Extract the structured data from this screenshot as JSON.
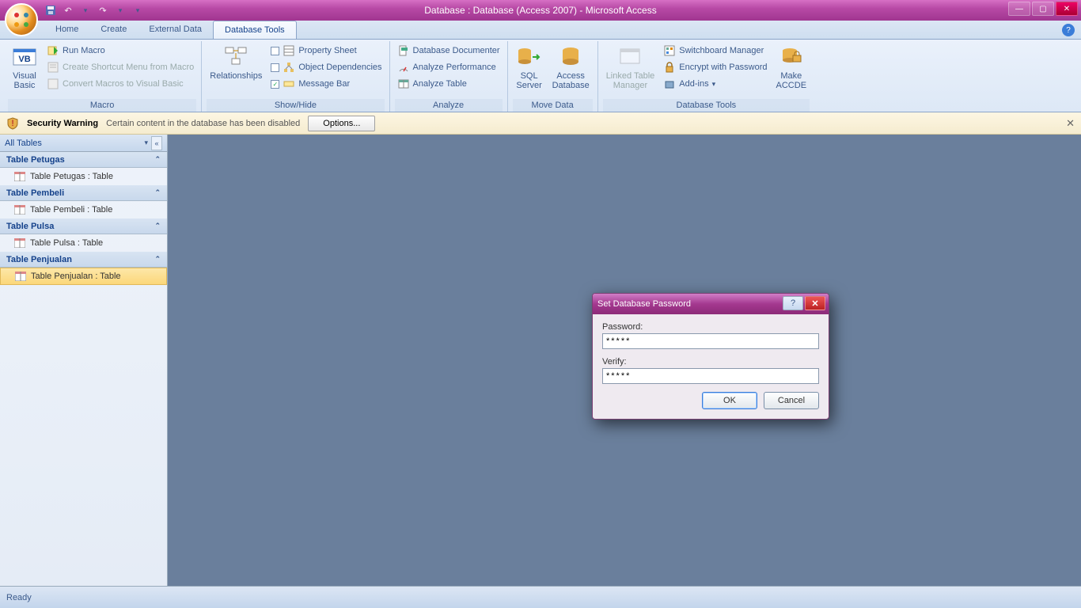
{
  "titlebar": {
    "title": "Database : Database (Access 2007) - Microsoft Access"
  },
  "tabs": [
    {
      "label": "Home"
    },
    {
      "label": "Create"
    },
    {
      "label": "External Data"
    },
    {
      "label": "Database Tools"
    }
  ],
  "ribbon": {
    "macro": {
      "label": "Macro",
      "visual_basic": "Visual\nBasic",
      "run_macro": "Run Macro",
      "shortcut": "Create Shortcut Menu from Macro",
      "convert": "Convert Macros to Visual Basic"
    },
    "showhide": {
      "label": "Show/Hide",
      "relationships": "Relationships",
      "propsheet": "Property Sheet",
      "objdep": "Object Dependencies",
      "msgbar": "Message Bar"
    },
    "analyze": {
      "label": "Analyze",
      "documenter": "Database Documenter",
      "perf": "Analyze Performance",
      "table": "Analyze Table"
    },
    "movedata": {
      "label": "Move Data",
      "sql": "SQL\nServer",
      "access": "Access\nDatabase"
    },
    "dbtools": {
      "label": "Database Tools",
      "linked": "Linked Table\nManager",
      "switchboard": "Switchboard Manager",
      "encrypt": "Encrypt with Password",
      "addins": "Add-ins",
      "accde": "Make\nACCDE"
    }
  },
  "security": {
    "title": "Security Warning",
    "msg": "Certain content in the database has been disabled",
    "options": "Options..."
  },
  "nav": {
    "header": "All Tables",
    "groups": [
      {
        "name": "Table Petugas",
        "item": "Table Petugas : Table"
      },
      {
        "name": "Table Pembeli",
        "item": "Table Pembeli : Table"
      },
      {
        "name": "Table Pulsa",
        "item": "Table Pulsa : Table"
      },
      {
        "name": "Table Penjualan",
        "item": "Table Penjualan : Table"
      }
    ]
  },
  "dialog": {
    "title": "Set Database Password",
    "password_label": "Password:",
    "password_value": "*****",
    "verify_label": "Verify:",
    "verify_value": "*****",
    "ok": "OK",
    "cancel": "Cancel"
  },
  "status": {
    "ready": "Ready"
  }
}
